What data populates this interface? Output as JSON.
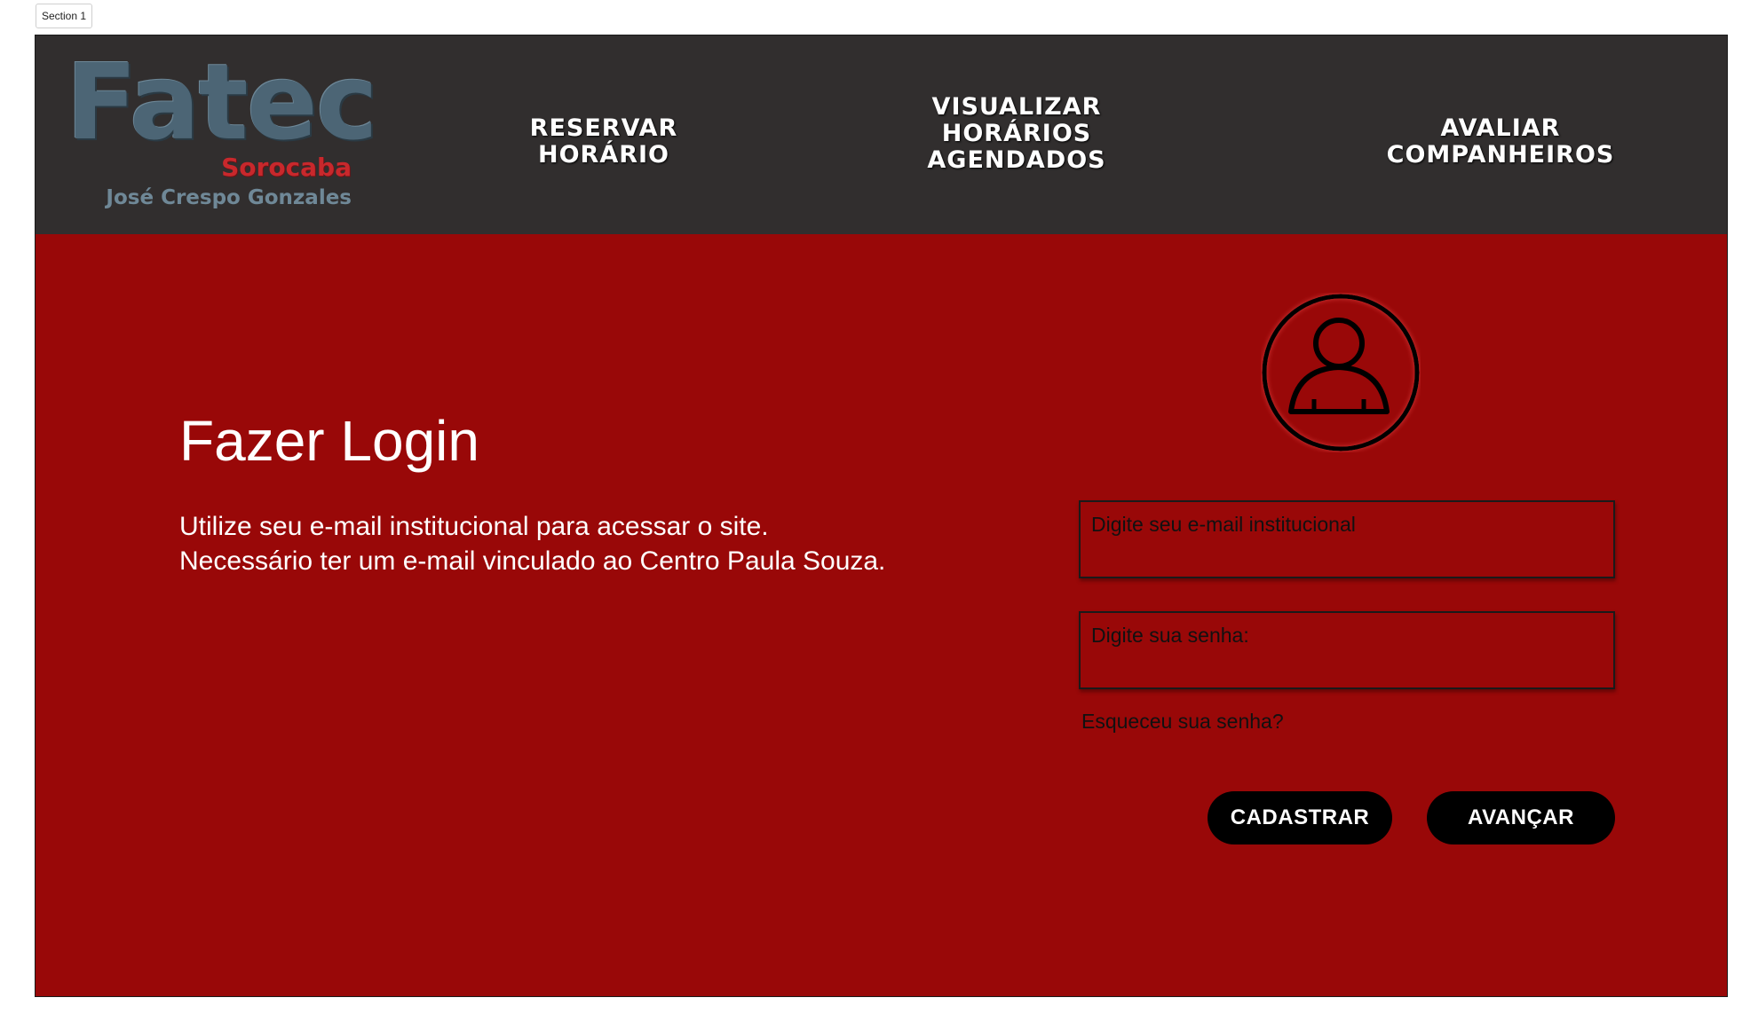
{
  "section_tag": "Section 1",
  "logo": {
    "main": "Fatec",
    "city": "Sorocaba",
    "name": "José Crespo Gonzales"
  },
  "nav": {
    "items": [
      {
        "label": "RESERVAR\nHORÁRIO"
      },
      {
        "label": "VISUALIZAR\nHORÁRIOS\nAGENDADOS"
      },
      {
        "label": "AVALIAR\nCOMPANHEIROS"
      }
    ]
  },
  "login": {
    "title": "Fazer Login",
    "description_line1": "Utilize seu e-mail institucional  para acessar o site.",
    "description_line2": "Necessário ter um e-mail vinculado ao Centro Paula Souza.",
    "email_placeholder": "Digite seu e-mail institucional",
    "password_placeholder": "Digite sua senha:",
    "forgot_label": "Esqueceu sua senha?",
    "register_label": "CADASTRAR",
    "next_label": "AVANÇAR",
    "avatar_icon": "user-avatar-icon"
  },
  "colors": {
    "background": "#990808",
    "navbar": "#312e2e",
    "button": "#000000",
    "logo_blue": "#4c6575",
    "logo_red": "#c8282c"
  }
}
